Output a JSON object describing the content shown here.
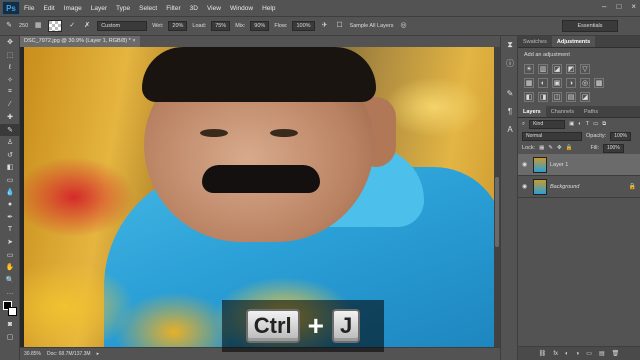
{
  "app": {
    "logo": "Ps"
  },
  "menu": [
    "File",
    "Edit",
    "Image",
    "Layer",
    "Type",
    "Select",
    "Filter",
    "3D",
    "View",
    "Window",
    "Help"
  ],
  "window_controls": {
    "minimize": "–",
    "maximize": "□",
    "close": "×"
  },
  "options_bar": {
    "brush_size": "250",
    "preset": "Custom",
    "wet_label": "Wet:",
    "wet": "20%",
    "load_label": "Load:",
    "load": "75%",
    "mix_label": "Mix:",
    "mix": "90%",
    "flow_label": "Flow:",
    "flow": "100%",
    "sample_all_layers": "Sample All Layers",
    "workspace": "Essentials"
  },
  "document": {
    "tab_title": "DSC_7972.jpg @ 30.9% (Layer 1, RGB/8) *",
    "close": "×"
  },
  "status_bar": {
    "zoom": "30.85%",
    "doc_info": "Doc: 68.7M/137.3M",
    "arrow": "▸"
  },
  "shortcut": {
    "key1": "Ctrl",
    "plus": "+",
    "key2": "J"
  },
  "adjustments_panel": {
    "tabs": [
      "Swatches",
      "Adjustments"
    ],
    "title": "Add an adjustment",
    "row1": [
      "☀",
      "▥",
      "◪",
      "◩",
      "▽"
    ],
    "row2": [
      "▦",
      "◐",
      "▣",
      "◑",
      "◎",
      "▩"
    ],
    "row3": [
      "◧",
      "◨",
      "◫",
      "▤",
      "◪"
    ]
  },
  "layers_panel": {
    "tabs": [
      "Layers",
      "Channels",
      "Paths"
    ],
    "kind": "Kind",
    "blend_mode": "Normal",
    "opacity_label": "Opacity:",
    "opacity": "100%",
    "lock_label": "Lock:",
    "fill_label": "Fill:",
    "fill": "100%",
    "layers": [
      {
        "name": "Layer 1",
        "selected": true,
        "locked": false
      },
      {
        "name": "Background",
        "selected": false,
        "locked": true
      }
    ],
    "footer": [
      "⛓",
      "fx",
      "◐",
      "◑",
      "▭",
      "▤",
      "🗑"
    ]
  },
  "colors": {
    "accent": "#31a8ff",
    "panel_bg": "#535353",
    "canvas_bg": "#282828"
  }
}
